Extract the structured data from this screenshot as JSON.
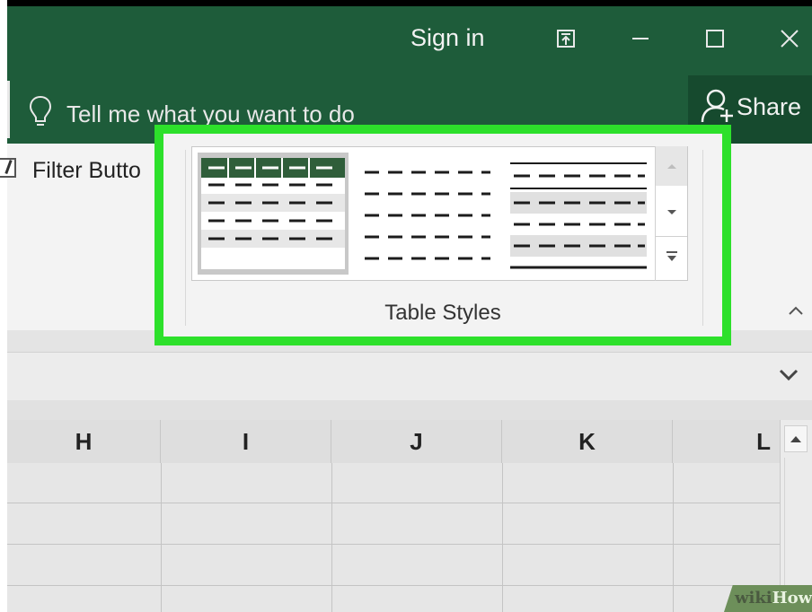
{
  "titlebar": {
    "sign_in": "Sign in",
    "buttons": [
      {
        "name": "ribbon-display-options-icon",
        "glyph": "⊼"
      },
      {
        "name": "minimize-icon",
        "glyph": "—"
      },
      {
        "name": "maximize-icon",
        "glyph": "☐"
      },
      {
        "name": "close-icon",
        "glyph": "✕"
      }
    ]
  },
  "tell_me": {
    "text": "Tell me what you want to do",
    "icon": "lightbulb-icon"
  },
  "share": {
    "label": "Share",
    "icon": "add-person-icon"
  },
  "ribbon": {
    "filter_button_label": "Filter Butto",
    "filter_checked": true,
    "table_styles": {
      "label": "Table Styles",
      "styles": [
        {
          "name": "green-banded-style",
          "selected": true
        },
        {
          "name": "plain-style",
          "selected": false
        },
        {
          "name": "banded-gray-style",
          "selected": false
        }
      ],
      "scroll": {
        "up": "▲",
        "down": "▼",
        "more": "⩡"
      }
    },
    "collapse_glyph": "^"
  },
  "formula_bar": {
    "expand_icon": "chevron-down-icon"
  },
  "columns": [
    "H",
    "I",
    "J",
    "K",
    "L"
  ],
  "watermark": {
    "part1": "wiki",
    "part2": "How"
  },
  "colors": {
    "accent": "#1e5c3a",
    "highlight": "#2de02b",
    "share_bg": "#164a2e"
  }
}
